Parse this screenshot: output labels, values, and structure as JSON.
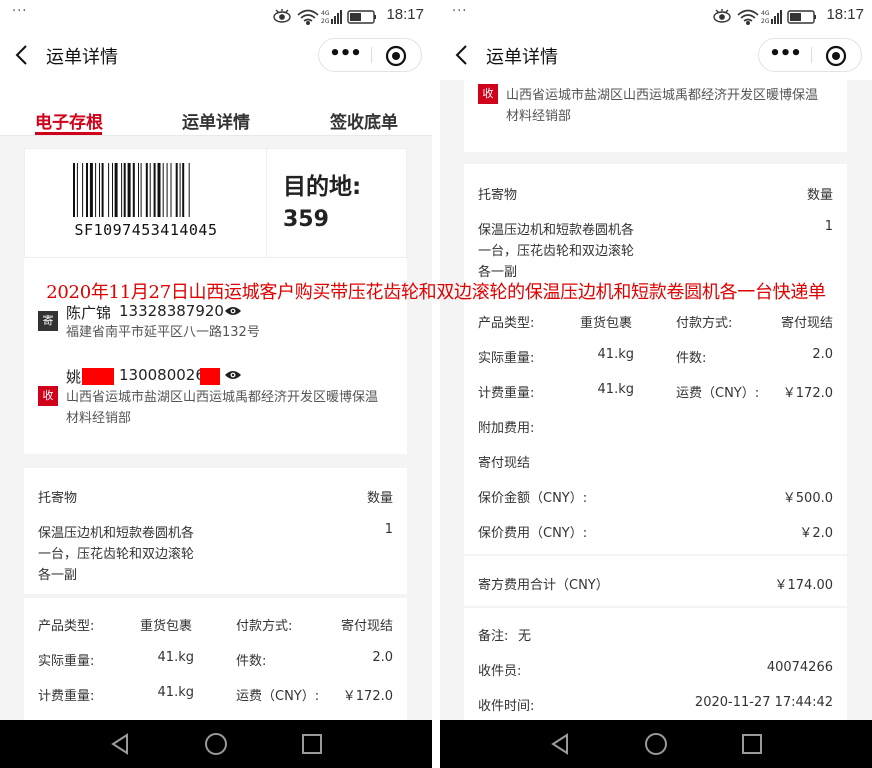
{
  "status_bar": {
    "dots": "···",
    "time": "18:17",
    "network": "4G 2G"
  },
  "nav": {
    "title": "运单详情",
    "more_label": "•••"
  },
  "tabs": [
    {
      "label": "电子存根",
      "active": true
    },
    {
      "label": "运单详情",
      "active": false
    },
    {
      "label": "签收底单",
      "active": false
    }
  ],
  "waybill": {
    "number": "SF1097453414045",
    "destination_label": "目的地:",
    "destination_code": "359"
  },
  "sender": {
    "badge": "寄",
    "name": "陈广锦",
    "phone": "13328387920",
    "address": "福建省南平市延平区八一路132号"
  },
  "receiver": {
    "badge": "收",
    "name": "姚",
    "phone": "130080026",
    "address_line1": "山西省运城市盐湖区山西运城禹都经济开发区暖博保温",
    "address_line2": "材料经销部"
  },
  "goods": {
    "header_left": "托寄物",
    "header_right": "数量",
    "item_line1": "保温压边机和短款卷圆机各",
    "item_line2": "一台，压花齿轮和双边滚轮",
    "item_line3": "各一副",
    "qty": "1"
  },
  "details": {
    "product_type_label": "产品类型:",
    "product_type": "重货包裹",
    "payment_label": "付款方式:",
    "payment": "寄付现结",
    "actual_weight_label": "实际重量:",
    "actual_weight": "41.kg",
    "pieces_label": "件数:",
    "pieces": "2.0",
    "billing_weight_label": "计费重量:",
    "billing_weight": "41.kg",
    "freight_label": "运费（CNY）:",
    "freight": "￥172.0",
    "extra_fee_label": "附加费用:",
    "extra_fee_note": "寄付现结",
    "insured_amount_label": "保价金额（CNY）:",
    "insured_amount": "￥500.0",
    "insurance_fee_label": "保价费用（CNY）:",
    "insurance_fee": "￥2.0",
    "total_label": "寄方费用合计（CNY）",
    "total": "￥174.00",
    "remark_label": "备注:",
    "remark": "无",
    "courier_label": "收件员:",
    "courier": "40074266",
    "pickup_time_label": "收件时间:",
    "pickup_time": "2020-11-27 17:44:42"
  },
  "caption": "2020年11月27日山西运城客户购买带压花齿轮和双边滚轮的保温压边机和短款卷圆机各一台快递单",
  "colors": {
    "accent": "#d0021b",
    "caption": "#e00000",
    "navbar": "#000000"
  }
}
